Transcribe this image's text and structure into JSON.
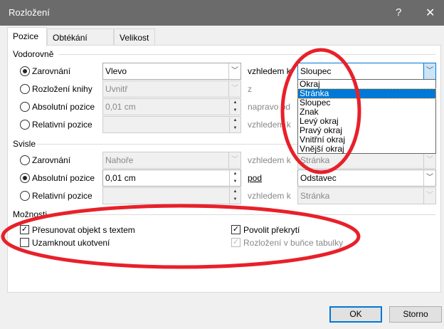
{
  "title": "Rozložení",
  "help": "?",
  "close": "✕",
  "tabs": [
    "Pozice",
    "Obtékání textu",
    "Velikost"
  ],
  "horizontal": {
    "label": "Vodorovně",
    "rows": [
      {
        "label": "Zarovnání",
        "value": "Vlevo",
        "rel_label": "vzhledem k",
        "rel_value": "Sloupec"
      },
      {
        "label": "Rozložení knihy",
        "value": "Uvnitř",
        "rel_label": "z"
      },
      {
        "label": "Absolutní pozice",
        "value": "0,01 cm",
        "rel_label": "napravo od"
      },
      {
        "label": "Relativní pozice",
        "value": "",
        "rel_label": "vzhledem k"
      }
    ],
    "dropdown_options": [
      "Okraj",
      "Stránka",
      "Sloupec",
      "Znak",
      "Levý okraj",
      "Pravý okraj",
      "Vnitřní okraj",
      "Vnější okraj"
    ],
    "dropdown_highlighted": "Stránka"
  },
  "vertical": {
    "label": "Svisle",
    "rows": [
      {
        "label": "Zarovnání",
        "value": "Nahoře",
        "rel_label": "vzhledem k",
        "rel_value": "Stránka"
      },
      {
        "label": "Absolutní pozice",
        "value": "0,01 cm",
        "rel_label": "pod",
        "rel_value": "Odstavec"
      },
      {
        "label": "Relativní pozice",
        "value": "",
        "rel_label": "vzhledem k",
        "rel_value": "Stránka"
      }
    ]
  },
  "options": {
    "label": "Možnosti",
    "move_with_text": "Přesunovat objekt s textem",
    "lock_anchor": "Uzamknout ukotvení",
    "allow_overlap": "Povolit překrytí",
    "layout_in_cell": "Rozložení v buňce tabulky"
  },
  "buttons": {
    "ok": "OK",
    "cancel": "Storno"
  },
  "annotation_color": "#e8202a"
}
